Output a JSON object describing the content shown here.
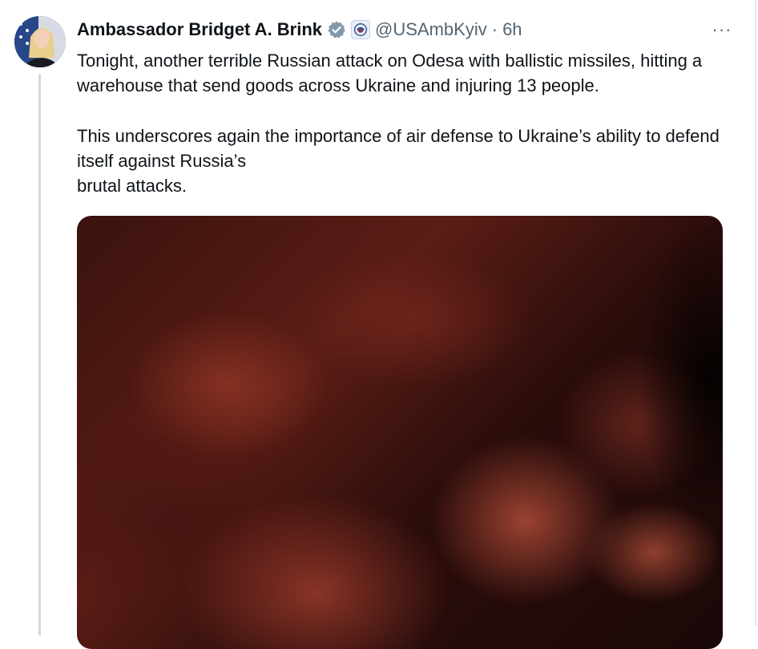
{
  "author": {
    "name": "Ambassador Bridget A. Brink",
    "handle": "@USAmbKyiv",
    "separator": "·",
    "time": "6h",
    "verified_icon": "verified-badge-icon",
    "affiliation_icon": "state-department-seal-icon",
    "avatar_icon": "profile-avatar"
  },
  "menu": {
    "more_label": "···"
  },
  "tweet": {
    "paragraph_1": "Tonight, another terrible Russian attack on Odesa with ballistic missiles, hitting a warehouse that send goods across Ukraine and injuring 13 people.",
    "paragraph_2_line_1": "This underscores again the importance of air defense to Ukraine’s ability to defend itself against Russia’s",
    "paragraph_2_line_2": "brutal attacks."
  },
  "colors": {
    "text_primary": "#0f1419",
    "text_secondary": "#536471",
    "verified_gray": "#829aab",
    "thread_line": "#cfd9de"
  }
}
